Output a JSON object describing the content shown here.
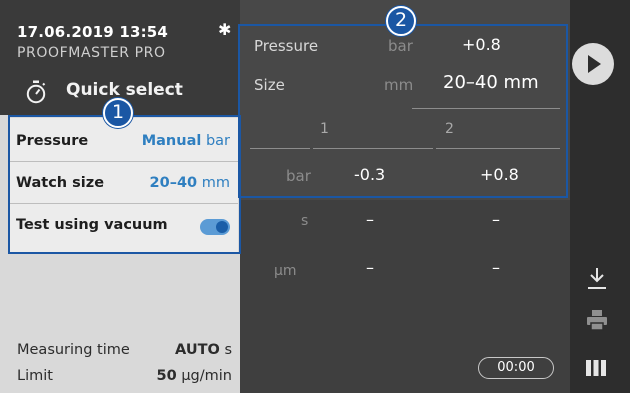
{
  "status_bar": {
    "datetime": "17.06.2019 13:54",
    "device_name": "PROOFMASTER PRO",
    "bluetooth_icon": "bluetooth-icon"
  },
  "quick_select": {
    "label": "Quick select",
    "icon": "stopwatch-icon"
  },
  "settings": {
    "pressure": {
      "label": "Pressure",
      "value": "Manual",
      "unit": "bar"
    },
    "watch_size": {
      "label": "Watch size",
      "value": "20–40",
      "unit": "mm"
    },
    "vacuum": {
      "label": "Test using vacuum",
      "enabled": true
    }
  },
  "footer_info": {
    "measuring_time": {
      "label": "Measuring time",
      "value": "AUTO",
      "unit": "s"
    },
    "limit": {
      "label": "Limit",
      "value": "50",
      "unit": "µg/min"
    }
  },
  "summary": {
    "pressure": {
      "label": "Pressure",
      "unit": "bar",
      "value": "+0.8"
    },
    "size": {
      "label": "Size",
      "unit": "mm",
      "value": "20–40 mm"
    }
  },
  "table": {
    "columns": [
      "1",
      "2"
    ],
    "rows": [
      {
        "unit": "bar",
        "values": [
          "-0.3",
          "+0.8"
        ]
      },
      {
        "unit": "s",
        "values": [
          "–",
          "–"
        ]
      },
      {
        "unit": "µm",
        "values": [
          "–",
          "–"
        ]
      }
    ]
  },
  "timer": "00:00",
  "toolbar": {
    "play": "play-icon",
    "save": "download-icon",
    "print": "print-icon",
    "menu": "menu-icon"
  },
  "callouts": {
    "one": "1",
    "two": "2"
  },
  "colors": {
    "accent": "#2f7fc0",
    "callout": "#1b57a4",
    "toggle_on": "#5b9bd5"
  }
}
